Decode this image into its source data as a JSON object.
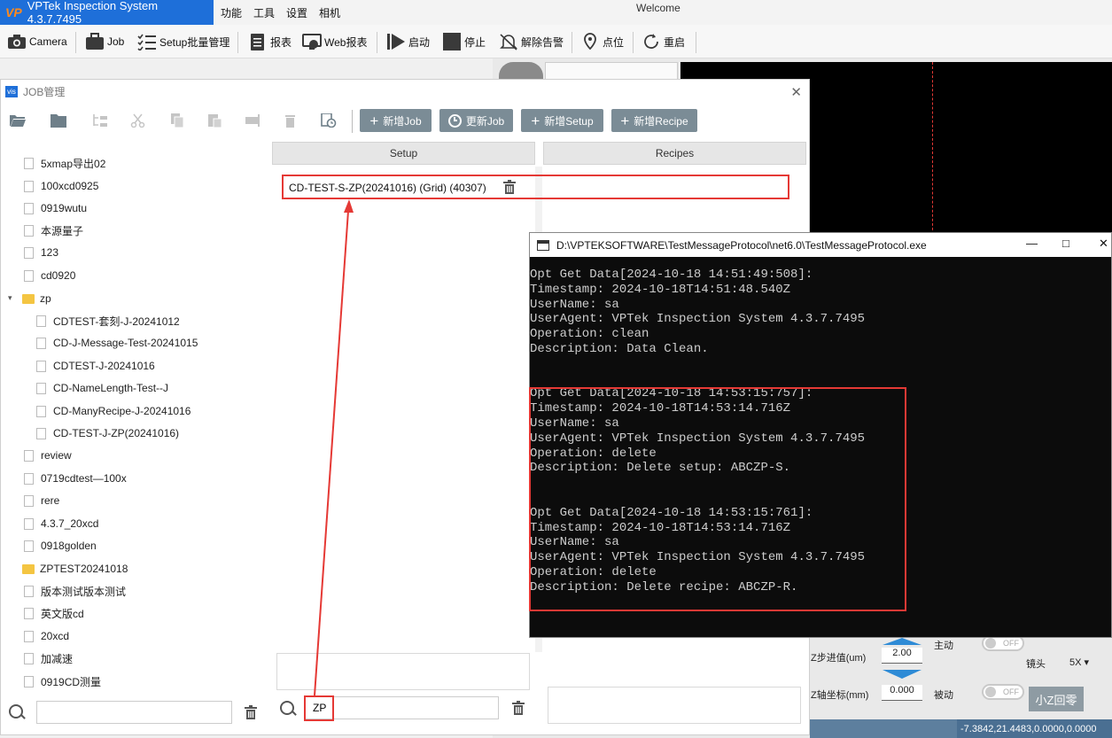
{
  "app": {
    "logo_mark": "VP",
    "title": "VPTek Inspection System 4.3.7.7495",
    "menu": [
      "功能",
      "工具",
      "设置",
      "相机"
    ],
    "welcome": "Welcome"
  },
  "toolbar": {
    "camera": "Camera",
    "job": "Job",
    "setup_batch": "Setup批量管理",
    "report": "报表",
    "web_report": "Web报表",
    "start": "启动",
    "stop": "停止",
    "clear_alarm": "解除告警",
    "point": "点位",
    "restart": "重启"
  },
  "controls": {
    "z_step_label": "Z步进值(um)",
    "z_step_value": "2.00",
    "z_coord_label": "Z轴坐标(mm)",
    "z_coord_value": "0.000",
    "active_label": "主动",
    "passive_label": "被动",
    "toggle_off": "OFF",
    "lens_label": "镜头",
    "lens_value": "5X",
    "z_home_button": "小Z回零",
    "status_coords": "-7.3842,21.4483,0.0000,0.0000"
  },
  "job_dialog": {
    "icon_text": "vis",
    "title": "JOB管理",
    "buttons": {
      "new_job": "新增Job",
      "update_job": "更新Job",
      "new_setup": "新增Setup",
      "new_recipe": "新增Recipe"
    },
    "tree": [
      "5xmap导出02",
      "100xcd0925",
      "0919wutu",
      "本源量子",
      "123",
      "cd0920",
      "zp",
      "CDTEST-套刻-J-20241012",
      "CD-J-Message-Test-20241015",
      "CDTEST-J-20241016",
      "CD-NameLength-Test--J",
      "CD-ManyRecipe-J-20241016",
      "CD-TEST-J-ZP(20241016)",
      "review",
      "0719cdtest—100x",
      "rere",
      "4.3.7_20xcd",
      "0918golden",
      "ZPTEST20241018",
      "版本测试版本测试",
      "英文版cd",
      "20xcd",
      "加减速",
      "0919CD测量"
    ],
    "setup_header": "Setup",
    "recipes_header": "Recipes",
    "setup_items": [
      "CD-TEST-S-ZP(20241016) (Grid) (40307)"
    ],
    "tree_search_value": "",
    "setup_search_value": "ZP"
  },
  "console": {
    "title": "D:\\VPTEKSOFTWARE\\TestMessageProtocol\\net6.0\\TestMessageProtocol.exe",
    "lines": [
      "Opt Get Data[2024-10-18 14:51:49:508]:",
      "Timestamp: 2024-10-18T14:51:48.540Z",
      "UserName: sa",
      "UserAgent: VPTek Inspection System 4.3.7.7495",
      "Operation: clean",
      "Description: Data Clean.",
      "",
      "",
      "Opt Get Data[2024-10-18 14:53:15:757]:",
      "Timestamp: 2024-10-18T14:53:14.716Z",
      "UserName: sa",
      "UserAgent: VPTek Inspection System 4.3.7.7495",
      "Operation: delete",
      "Description: Delete setup: ABCZP-S.",
      "",
      "",
      "Opt Get Data[2024-10-18 14:53:15:761]:",
      "Timestamp: 2024-10-18T14:53:14.716Z",
      "UserName: sa",
      "UserAgent: VPTek Inspection System 4.3.7.7495",
      "Operation: delete",
      "Description: Delete recipe: ABCZP-R."
    ]
  },
  "colors": {
    "brand_blue": "#1e6fd9",
    "button_gray": "#7b8c96",
    "annotation_red": "#e53935",
    "folder_yellow": "#f4c542"
  }
}
